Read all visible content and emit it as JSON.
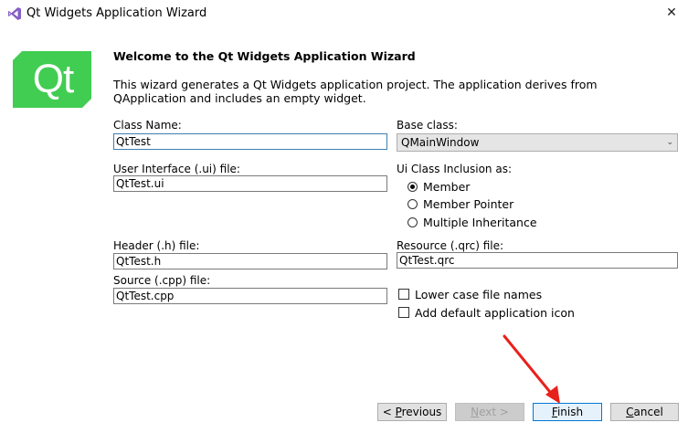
{
  "window": {
    "title": "Qt Widgets Application Wizard",
    "close_glyph": "✕",
    "logo_icon": "visual-studio-icon"
  },
  "header": {
    "logo_text": "Qt",
    "logo_color": "#41cd52",
    "welcome_title": "Welcome to the Qt Widgets Application Wizard",
    "description": "This wizard generates a Qt Widgets application project. The application derives from QApplication and includes an empty widget."
  },
  "form": {
    "class_name_label": "Class Name:",
    "class_name_value": "QtTest",
    "base_class_label": "Base class:",
    "base_class_value": "QMainWindow",
    "ui_file_label": "User Interface (.ui) file:",
    "ui_file_value": "QtTest.ui",
    "ui_inclusion_label": "Ui Class Inclusion as:",
    "ui_inclusion_options": [
      {
        "label": "Member",
        "checked": true
      },
      {
        "label": "Member Pointer",
        "checked": false
      },
      {
        "label": "Multiple Inheritance",
        "checked": false
      }
    ],
    "header_file_label": "Header (.h) file:",
    "header_file_value": "QtTest.h",
    "resource_file_label": "Resource (.qrc) file:",
    "resource_file_value": "QtTest.qrc",
    "source_file_label": "Source (.cpp) file:",
    "source_file_value": "QtTest.cpp",
    "lower_case_label": "Lower case file names",
    "default_icon_label": "Add default application icon"
  },
  "buttons": {
    "previous": {
      "prefix": "< ",
      "mnemonic": "P",
      "rest": "revious"
    },
    "next": {
      "mnemonic": "N",
      "rest": "ext >"
    },
    "finish": {
      "mnemonic": "F",
      "rest": "inish"
    },
    "cancel": {
      "mnemonic": "C",
      "rest": "ancel"
    }
  },
  "annotation": {
    "arrow_color": "#e8201a"
  }
}
